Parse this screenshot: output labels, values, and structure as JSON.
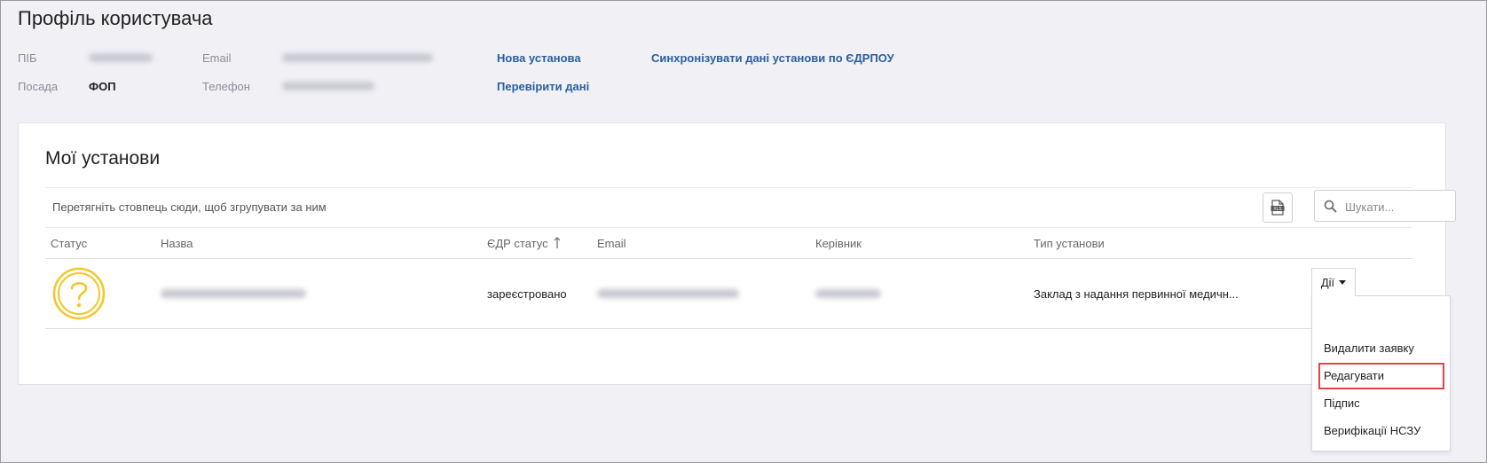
{
  "page_title": "Профіль користувача",
  "profile": {
    "pib_label": "ПІБ",
    "position_label": "Посада",
    "position_value": "ФОП",
    "email_label": "Email",
    "phone_label": "Телефон"
  },
  "links": {
    "new_institution": "Нова установа",
    "sync_edrpou": "Синхронізувати дані установи по ЄДРПОУ",
    "check_data": "Перевірити дані"
  },
  "institutions": {
    "title": "Мої установи",
    "group_panel_text": "Перетягніть стовпець сюди, щоб згрупувати за ним",
    "search_placeholder": "Шукати...",
    "columns": [
      "Статус",
      "Назва",
      "ЄДР статус",
      "Email",
      "Керівник",
      "Тип установи"
    ],
    "sorted_column_icon": "sort-ascending-icon",
    "rows": [
      {
        "status_icon": "question-circle-icon",
        "edr_status": "зареєстровано",
        "type": "Заклад з надання первинної медичн..."
      }
    ]
  },
  "actions": {
    "button_label": "Дії",
    "menu": [
      "Видалити заявку",
      "Редагувати",
      "Підпис",
      "Верифікації НСЗУ"
    ],
    "highlighted_item": "Редагувати"
  },
  "colors": {
    "background": "#f0f0f5",
    "link": "#2a5f9e",
    "status_icon": "#f2c72b",
    "highlight": "#e04444"
  }
}
